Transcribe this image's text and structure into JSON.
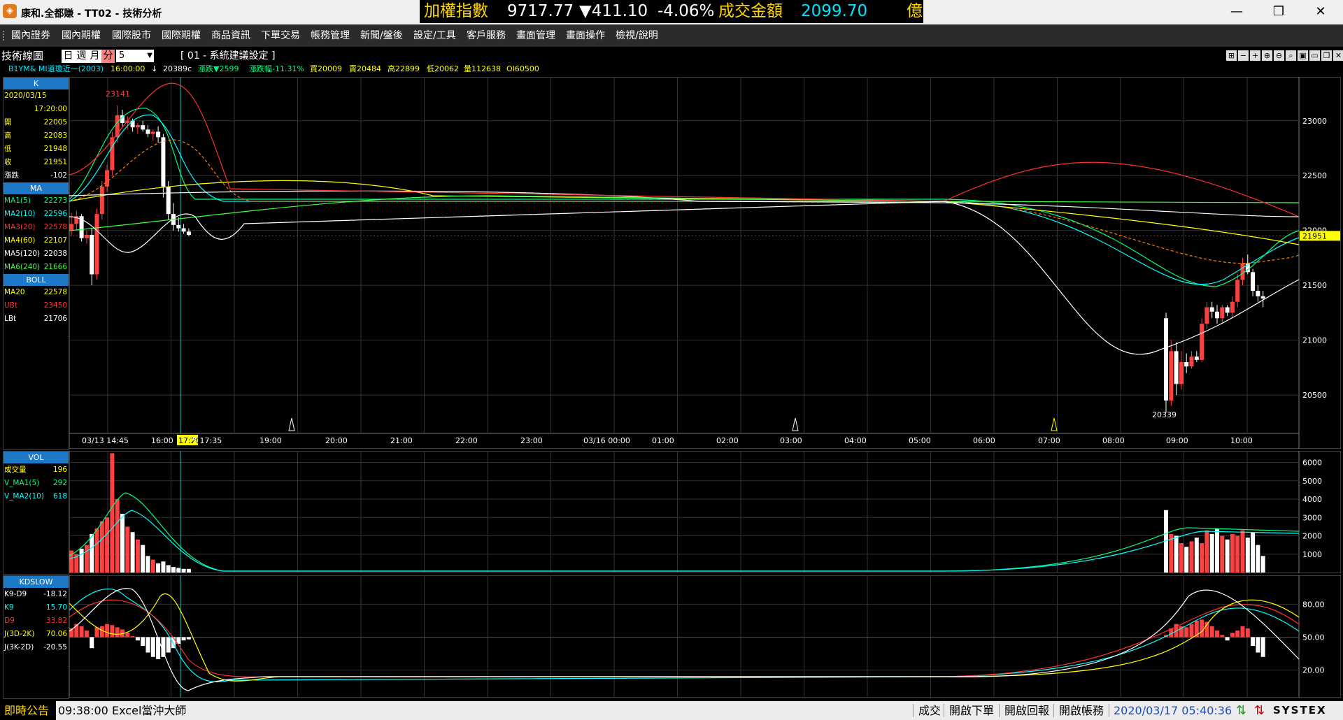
{
  "window": {
    "title": "康和.全都賺 - TT02 - 技術分析",
    "icon": "app-logo-icon",
    "ticker": {
      "name": "加權指數",
      "value": "9717.77",
      "change": "▼411.10",
      "pct": "-4.06%",
      "turnover_label": "成交金額",
      "turnover": "2099.70",
      "unit": "億"
    },
    "controls": {
      "minimize": "—",
      "maximize": "❐",
      "close": "✕"
    }
  },
  "menu": [
    "國內證券",
    "國內期權",
    "國際股市",
    "國際期權",
    "商品資訊",
    "下單交易",
    "帳務管理",
    "新聞/盤後",
    "設定/工具",
    "客戶服務",
    "畫面管理",
    "畫面操作",
    "檢視/說明"
  ],
  "toolbar": {
    "panel_title": "技術線圖",
    "periods": [
      "日",
      "週",
      "月",
      "分"
    ],
    "active_period": "分",
    "interval": "5",
    "preset": "[ 01 - 系統建議設定 ]"
  },
  "quote": {
    "symbol": "B1YM&  MI道瓊近一(2003)",
    "time": "16:00:00",
    "last": "20389c",
    "change": "漲跌▼2599",
    "pct": "漲跌幅-11.31%",
    "bid": "買20009",
    "ask": "賣20484",
    "high": "高22899",
    "low": "低20062",
    "vol": "量112638",
    "oi": "OI60500"
  },
  "k_panel": {
    "title": "K",
    "date": "2020/03/15",
    "time": "17:20:00",
    "rows": [
      {
        "label": "開",
        "value": "22005"
      },
      {
        "label": "高",
        "value": "22083"
      },
      {
        "label": "低",
        "value": "21948"
      },
      {
        "label": "收",
        "value": "21951"
      },
      {
        "label": "漲跌",
        "value": "-102"
      }
    ]
  },
  "ma_panel": {
    "title": "MA",
    "rows": [
      {
        "label": "MA1(5)",
        "value": "22273",
        "color": "#00ff80"
      },
      {
        "label": "MA2(10)",
        "value": "22596",
        "color": "#00ffff"
      },
      {
        "label": "MA3(20)",
        "value": "22578",
        "color": "#ff3030"
      },
      {
        "label": "MA4(60)",
        "value": "22107",
        "color": "#ffff00"
      },
      {
        "label": "MA5(120)",
        "value": "22038",
        "color": "#ffffff"
      },
      {
        "label": "MA6(240)",
        "value": "21666",
        "color": "#40ff40"
      }
    ]
  },
  "boll_panel": {
    "title": "BOLL",
    "rows": [
      {
        "label": "MA20",
        "value": "22578",
        "color": "#ffff00"
      },
      {
        "label": "UBt",
        "value": "23450",
        "color": "#ff3030"
      },
      {
        "label": "LBt",
        "value": "21706",
        "color": "#ffffff"
      }
    ]
  },
  "vol_panel": {
    "title": "VOL",
    "rows": [
      {
        "label": "成交量",
        "value": "196",
        "color": "#ffff00"
      },
      {
        "label": "V_MA1(5)",
        "value": "292",
        "color": "#00ff80"
      },
      {
        "label": "V_MA2(10)",
        "value": "618",
        "color": "#00ffff"
      }
    ]
  },
  "kd_panel": {
    "title": "KDSLOW",
    "rows": [
      {
        "label": "K9-D9",
        "value": "-18.12",
        "color": "#ffffff"
      },
      {
        "label": "K9",
        "value": "15.70",
        "color": "#00ffff"
      },
      {
        "label": "D9",
        "value": "33.82",
        "color": "#ff3030"
      },
      {
        "label": "J(3D-2K)",
        "value": "70.06",
        "color": "#ffff00"
      },
      {
        "label": "J(3K-2D)",
        "value": "-20.55",
        "color": "#ffffff"
      }
    ]
  },
  "chart_data": {
    "type": "candlestick",
    "price_axis": {
      "ticks": [
        "23000",
        "22500",
        "22000",
        "21500",
        "21000",
        "20500"
      ],
      "current": "21951",
      "ylim": [
        20150,
        23400
      ]
    },
    "time_axis": {
      "ticks": [
        "03/13 14:45",
        "16:00",
        "17:20",
        "5 17:35",
        "19:00",
        "20:00",
        "21:00",
        "22:00",
        "23:00",
        "03/16 00:00",
        "01:00",
        "02:00",
        "03:00",
        "04:00",
        "05:00",
        "06:00",
        "07:00",
        "08:00",
        "09:00",
        "10:00"
      ]
    },
    "annotations": {
      "high": "23141",
      "low": "20339"
    },
    "vol_axis": {
      "ticks": [
        "6000",
        "5000",
        "4000",
        "3000",
        "2000",
        "1000"
      ],
      "ylim": [
        0,
        6400
      ]
    },
    "kd_axis": {
      "ticks": [
        "80.00",
        "50.00",
        "20.00"
      ],
      "ylim": [
        0,
        100
      ]
    },
    "candles": [
      [
        22005,
        22160,
        21948,
        22060
      ],
      [
        22060,
        22180,
        22000,
        22130
      ],
      [
        22130,
        22150,
        21900,
        21930
      ],
      [
        21930,
        22000,
        21880,
        21960
      ],
      [
        21960,
        22020,
        21500,
        21600
      ],
      [
        21600,
        22200,
        21550,
        22150
      ],
      [
        22150,
        22450,
        22100,
        22400
      ],
      [
        22400,
        22600,
        22350,
        22550
      ],
      [
        22550,
        22900,
        22500,
        22850
      ],
      [
        22850,
        23141,
        22800,
        23050
      ],
      [
        23050,
        23100,
        22950,
        22980
      ],
      [
        22980,
        23040,
        22920,
        23000
      ],
      [
        23000,
        23020,
        22900,
        22940
      ],
      [
        22940,
        22980,
        22880,
        22960
      ],
      [
        22960,
        23000,
        22900,
        22920
      ],
      [
        22920,
        22960,
        22850,
        22880
      ],
      [
        22880,
        22920,
        22820,
        22900
      ],
      [
        22900,
        22950,
        22800,
        22850
      ],
      [
        22850,
        22880,
        22300,
        22400
      ],
      [
        22400,
        22450,
        22100,
        22150
      ],
      [
        22150,
        22250,
        22000,
        22050
      ],
      [
        22050,
        22120,
        21990,
        22020
      ],
      [
        22020,
        22060,
        21970,
        21990
      ],
      [
        21990,
        22020,
        21948,
        21960
      ]
    ],
    "candles_b": [
      [
        21200,
        21250,
        20339,
        20450
      ],
      [
        20450,
        21000,
        20400,
        20900
      ],
      [
        20900,
        20980,
        20500,
        20600
      ],
      [
        20600,
        20900,
        20550,
        20800
      ],
      [
        20800,
        20880,
        20700,
        20760
      ],
      [
        20760,
        20900,
        20740,
        20850
      ],
      [
        20850,
        20900,
        20800,
        20820
      ],
      [
        20820,
        21200,
        20800,
        21150
      ],
      [
        21150,
        21350,
        21100,
        21300
      ],
      [
        21300,
        21350,
        21200,
        21260
      ],
      [
        21260,
        21320,
        21150,
        21200
      ],
      [
        21200,
        21320,
        21150,
        21300
      ],
      [
        21300,
        21320,
        21220,
        21250
      ],
      [
        21250,
        21400,
        21200,
        21350
      ],
      [
        21350,
        21600,
        21300,
        21550
      ],
      [
        21550,
        21750,
        21500,
        21700
      ],
      [
        21700,
        21780,
        21600,
        21620
      ],
      [
        21620,
        21650,
        21400,
        21450
      ],
      [
        21450,
        21500,
        21350,
        21400
      ],
      [
        21400,
        21450,
        21300,
        21380
      ]
    ],
    "volumes_a": [
      1200,
      1000,
      1300,
      1500,
      2100,
      2400,
      2800,
      3000,
      6500,
      4000,
      3200,
      2500,
      2200,
      1800,
      1500,
      900,
      700,
      500,
      600,
      400,
      300,
      250,
      200,
      196
    ],
    "volumes_b": [
      3400,
      2100,
      2000,
      1600,
      1400,
      1700,
      1900,
      1600,
      2300,
      2100,
      2400,
      2000,
      1800,
      2100,
      2000,
      2300,
      1900,
      2200,
      1500,
      900
    ]
  }
}
